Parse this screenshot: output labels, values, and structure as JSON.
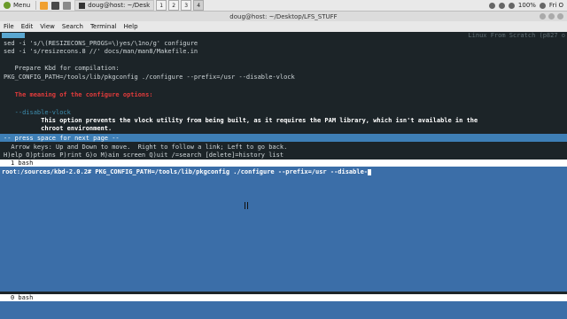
{
  "panel": {
    "menu_label": "Menu",
    "task_title": "doug@host: ~/Desk",
    "workspaces": [
      "1",
      "2",
      "3",
      "4"
    ],
    "active_workspace": "4",
    "battery": "100%",
    "clock": "Fri O"
  },
  "window": {
    "title": "doug@host: ~/Desktop/LFS_STUFF"
  },
  "menubar": [
    "File",
    "Edit",
    "View",
    "Search",
    "Terminal",
    "Help"
  ],
  "terminal": {
    "banner": "Linux From Scratch (p827 o",
    "lines": [
      "sed -i 's/\\(RESIZECONS_PROGS=\\)yes/\\1no/g' configure",
      "sed -i 's/resizecons.8 //' docs/man/man8/Makefile.in",
      "",
      "   Prepare Kbd for compilation:",
      "PKG_CONFIG_PATH=/tools/lib/pkgconfig ./configure --prefix=/usr --disable-vlock",
      "",
      "   The meaning of the configure options:",
      "",
      "   --disable-vlock",
      "          This option prevents the vlock utility from being built, as it requires the PAM library, which isn't available in the",
      "          chroot environment."
    ],
    "status": "-- press space for next page --",
    "help1": "  Arrow keys: Up and Down to move.  Right to follow a link; Left to go back.",
    "help2": "H)elp O)ptions P)rint G)o M)ain screen Q)uit /=search [delete]=history list",
    "tmux_top": "1 bash",
    "prompt": "root:/sources/kbd-2.0.2# PKG_CONFIG_PATH=/tools/lib/pkgconfig ./configure --prefix=/usr --disable-",
    "tmux_bottom": "0 bash"
  }
}
